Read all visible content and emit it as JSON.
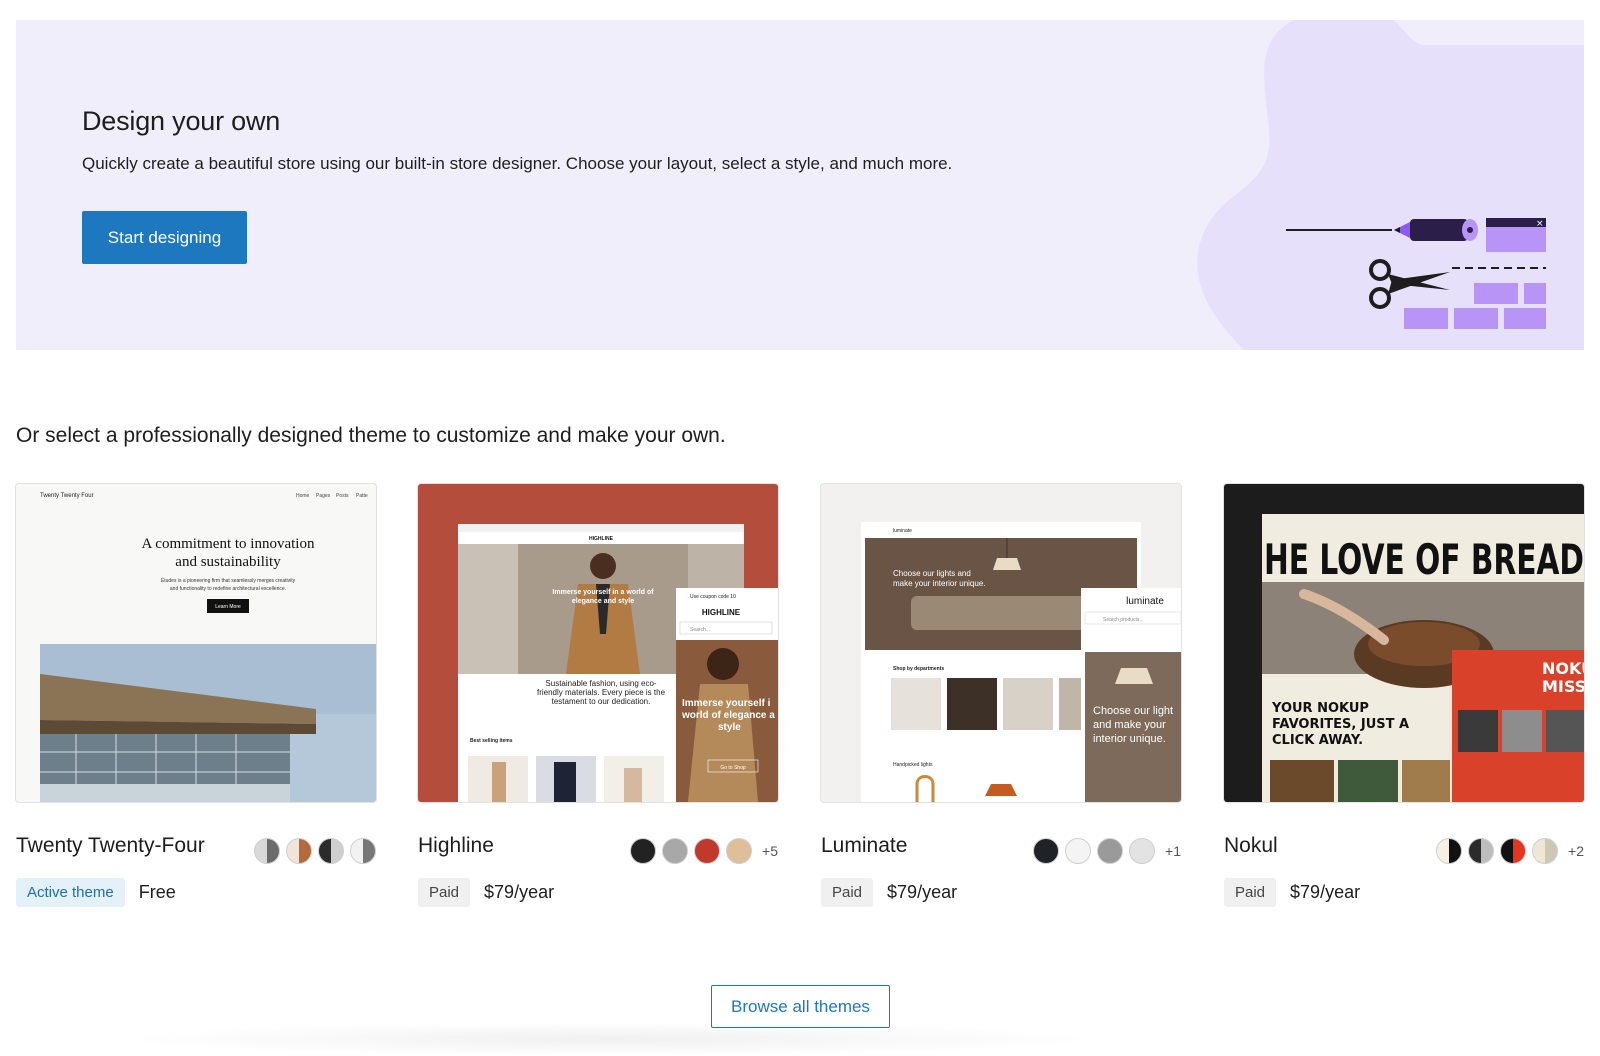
{
  "hero": {
    "title": "Design your own",
    "description": "Quickly create a beautiful store using our built-in store designer. Choose your layout, select a style, and much more.",
    "button_label": "Start designing",
    "accent_color": "#1e78c0",
    "background_color": "#f1eefc",
    "illustration": "scissors-and-blocks-illustration"
  },
  "subheading": "Or select a professionally designed theme to customize and make your own.",
  "themes": [
    {
      "name": "Twenty Twenty-Four",
      "badge": "Active theme",
      "price": "Free",
      "extra_variations": "",
      "preview": {
        "site_name": "Twenty Twenty Four",
        "nav": [
          "Home",
          "Pages",
          "Posts",
          "Patte"
        ],
        "headline_1": "A commitment to innovation",
        "headline_2": "and sustainability",
        "body_1": "Études is a pioneering firm that seamlessly merges creativity",
        "body_2": "and functionality to redefine architectural excellence.",
        "button": "Learn More"
      }
    },
    {
      "name": "Highline",
      "badge": "Paid",
      "price": "$79/year",
      "extra_variations": "+5",
      "preview": {
        "brand": "HIGHLINE",
        "hero_1": "Immerse yourself in a world of",
        "hero_2": "elegance and style",
        "sustain_1": "Sustainable fashion, using eco-",
        "sustain_2": "friendly materials. Every piece is the",
        "sustain_3": "testament to our dedication.",
        "best_selling": "Best selling items",
        "promo": "Use coupon code 10",
        "search": "Search...",
        "mobile_1": "Immerse yourself i",
        "mobile_2": "world of elegance a",
        "mobile_3": "style",
        "shop": "Go to Shop"
      }
    },
    {
      "name": "Luminate",
      "badge": "Paid",
      "price": "$79/year",
      "extra_variations": "+1",
      "preview": {
        "brand": "luminate",
        "hero_1": "Choose our lights and",
        "hero_2": "make your interior unique.",
        "shop_by": "Shop by departments",
        "handpicked": "Handpicked lights",
        "search": "Search products...",
        "mobile_1": "Choose our light",
        "mobile_2": "and make your",
        "mobile_3": "interior unique."
      }
    },
    {
      "name": "Nokul",
      "badge": "Paid",
      "price": "$79/year",
      "extra_variations": "+2",
      "preview": {
        "headline": "HE LOVE OF BREAD",
        "fav_1": "YOUR NOKUP",
        "fav_2": "FAVORITES, JUST A",
        "fav_3": "CLICK AWAY.",
        "side_1": "NOKU",
        "side_2": "MISSI"
      }
    }
  ],
  "browse_label": "Browse all themes",
  "swatch_colors": {
    "twenty_twenty_four": [
      "#d9d9d9|#6b6b6b",
      "#f2e4d6|#b46a3a",
      "#2b2b2b|#cfcfcf",
      "#f2f2f2|#777777"
    ],
    "highline": [
      "#222222",
      "#a8a8a8",
      "#c0392b",
      "#dfbf99"
    ],
    "luminate": [
      "#1f2226",
      "#f4f4f4",
      "#9a9a9a",
      "#e3e3e3"
    ],
    "nokul": [
      "#f4f0e2|#111111",
      "#2b2b2b|#bdbdbd",
      "#111111|#e8331e",
      "#efe7d6|#cdc7b6"
    ]
  }
}
